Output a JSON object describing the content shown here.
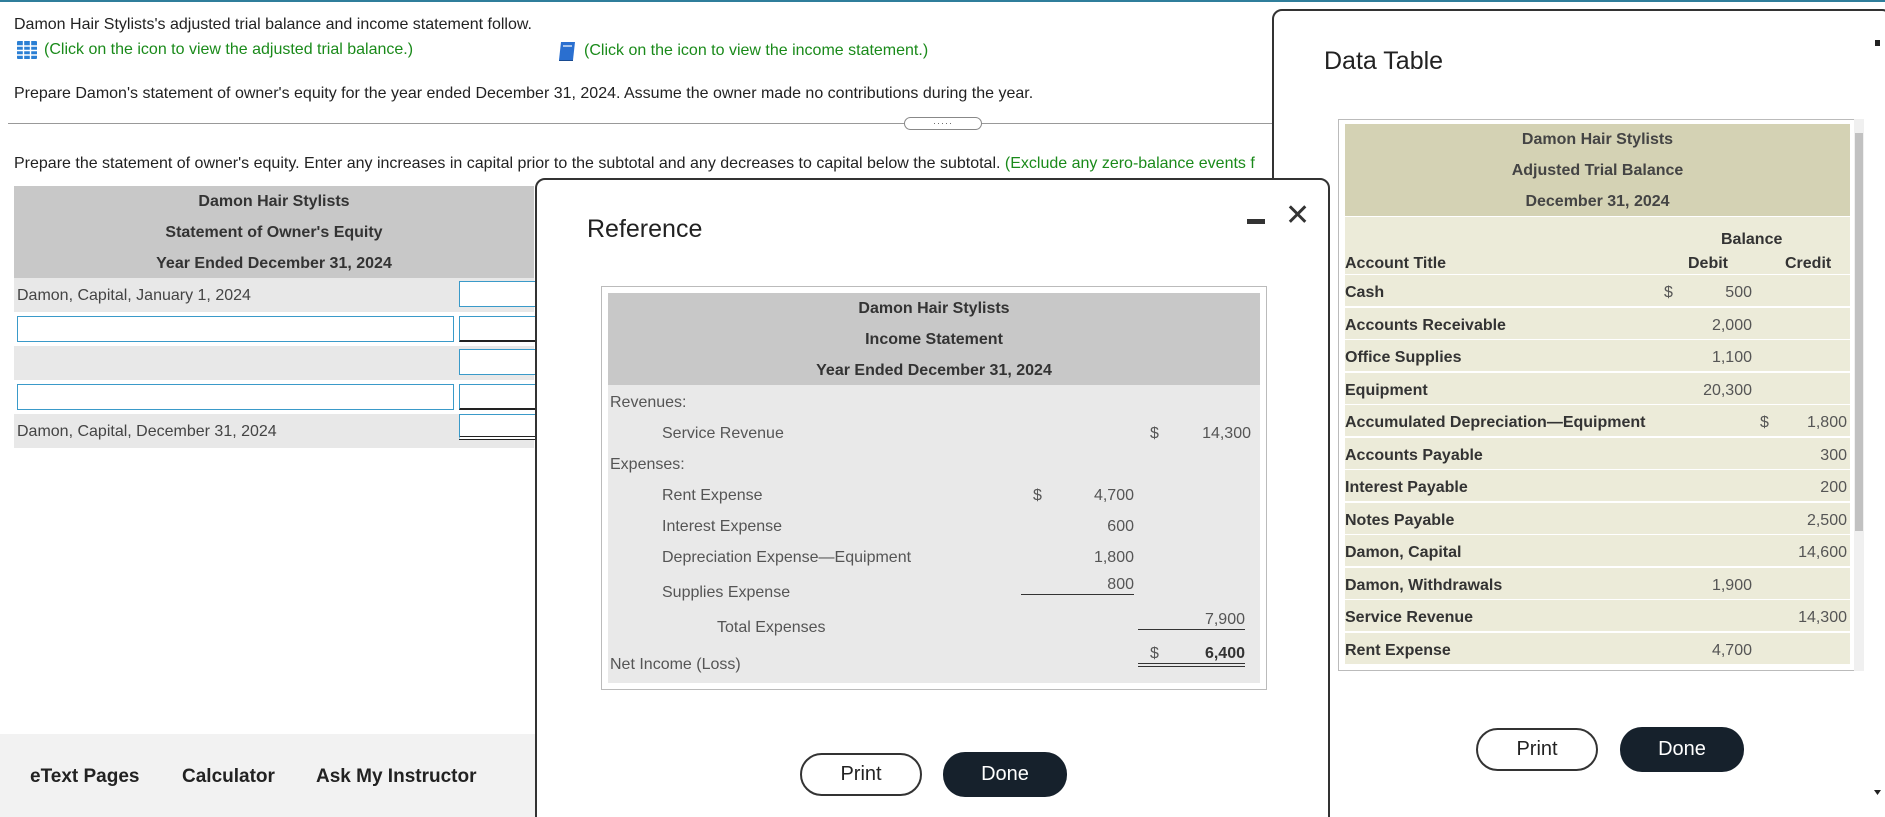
{
  "intro": "Damon Hair Stylists's adjusted trial balance and income statement follow.",
  "links": {
    "trial_balance": "(Click on the icon to view the adjusted trial balance.)",
    "income_statement": "(Click on the icon to view the income statement.)"
  },
  "task": "Prepare Damon's statement of owner's equity for the year ended December 31, 2024. Assume the owner made no contributions during the year.",
  "divider_handle": "·····",
  "instructions": {
    "text": "Prepare the statement of owner's equity. Enter any increases in capital prior to the subtotal and any decreases to capital below the subtotal.",
    "green": "(Exclude any zero-balance events f"
  },
  "soe": {
    "company": "Damon Hair Stylists",
    "title": "Statement of Owner's Equity",
    "period": "Year Ended December 31, 2024",
    "row_begin": "Damon, Capital, January 1, 2024",
    "row_end": "Damon, Capital, December 31, 2024"
  },
  "bottom_bar": {
    "etext": "eText Pages",
    "calculator": "Calculator",
    "ask": "Ask My Instructor"
  },
  "reference": {
    "title": "Reference",
    "company": "Damon Hair Stylists",
    "statement": "Income Statement",
    "period": "Year Ended December 31, 2024",
    "revenues_label": "Revenues:",
    "service_revenue": "Service Revenue",
    "service_revenue_sym": "$",
    "service_revenue_val": "14,300",
    "expenses_label": "Expenses:",
    "expenses": [
      {
        "label": "Rent Expense",
        "sym": "$",
        "value": "4,700"
      },
      {
        "label": "Interest Expense",
        "sym": "",
        "value": "600"
      },
      {
        "label": "Depreciation Expense—Equipment",
        "sym": "",
        "value": "1,800"
      },
      {
        "label": "Supplies Expense",
        "sym": "",
        "value": "800"
      }
    ],
    "total_expenses_label": "Total Expenses",
    "total_expenses_val": "7,900",
    "net_income_label": "Net Income (Loss)",
    "net_income_sym": "$",
    "net_income_val": "6,400",
    "print": "Print",
    "done": "Done"
  },
  "data_table": {
    "title": "Data Table",
    "company": "Damon Hair Stylists",
    "statement": "Adjusted Trial Balance",
    "date": "December 31, 2024",
    "balance_header": "Balance",
    "col_account": "Account Title",
    "col_debit": "Debit",
    "col_credit": "Credit",
    "rows": [
      {
        "account": "Cash",
        "dsym": "$",
        "debit": "500",
        "csym": "",
        "credit": ""
      },
      {
        "account": "Accounts Receivable",
        "dsym": "",
        "debit": "2,000",
        "csym": "",
        "credit": ""
      },
      {
        "account": "Office Supplies",
        "dsym": "",
        "debit": "1,100",
        "csym": "",
        "credit": ""
      },
      {
        "account": "Equipment",
        "dsym": "",
        "debit": "20,300",
        "csym": "",
        "credit": ""
      },
      {
        "account": "Accumulated Depreciation—Equipment",
        "dsym": "",
        "debit": "",
        "csym": "$",
        "credit": "1,800"
      },
      {
        "account": "Accounts Payable",
        "dsym": "",
        "debit": "",
        "csym": "",
        "credit": "300"
      },
      {
        "account": "Interest Payable",
        "dsym": "",
        "debit": "",
        "csym": "",
        "credit": "200"
      },
      {
        "account": "Notes Payable",
        "dsym": "",
        "debit": "",
        "csym": "",
        "credit": "2,500"
      },
      {
        "account": "Damon, Capital",
        "dsym": "",
        "debit": "",
        "csym": "",
        "credit": "14,600"
      },
      {
        "account": "Damon, Withdrawals",
        "dsym": "",
        "debit": "1,900",
        "csym": "",
        "credit": ""
      },
      {
        "account": "Service Revenue",
        "dsym": "",
        "debit": "",
        "csym": "",
        "credit": "14,300"
      },
      {
        "account": "Rent Expense",
        "dsym": "",
        "debit": "4,700",
        "csym": "",
        "credit": ""
      }
    ],
    "print": "Print",
    "done": "Done"
  }
}
